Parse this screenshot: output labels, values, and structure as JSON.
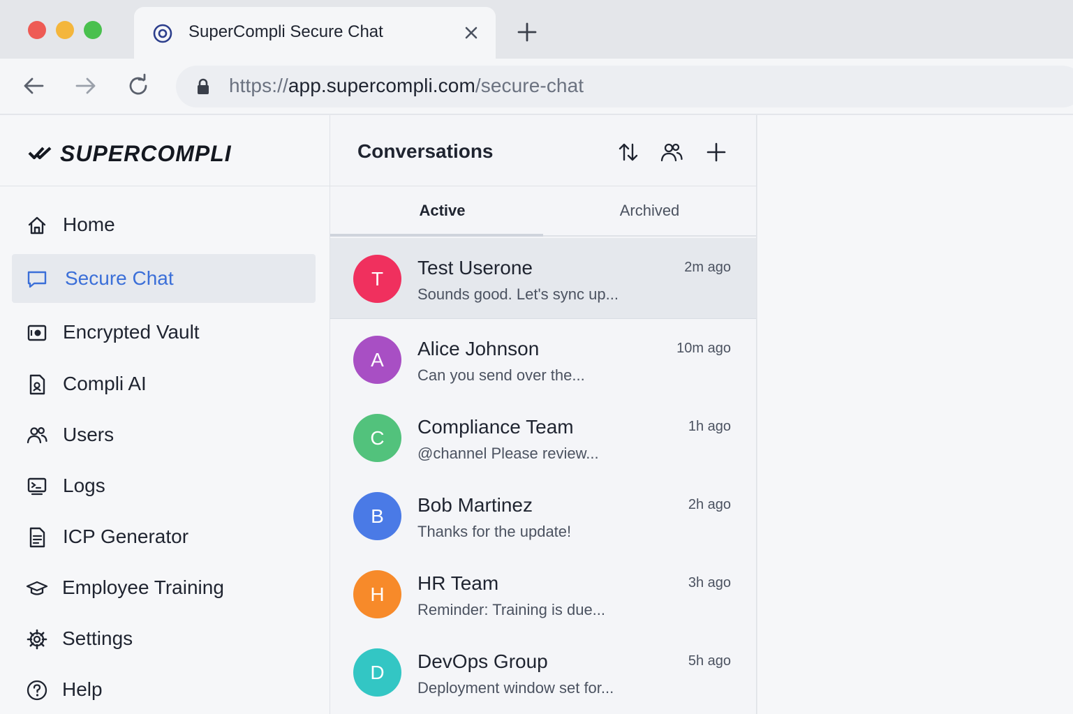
{
  "browser": {
    "tab": {
      "title": "SuperCompli Secure Chat"
    },
    "address": {
      "scheme": "https://",
      "host": "app.supercompli.com",
      "path": "/secure-chat"
    }
  },
  "sidebar": {
    "logo": "SUPERCOMPLI",
    "items": [
      {
        "label": "Home",
        "icon": "home-icon"
      },
      {
        "label": "Secure Chat",
        "icon": "chat-icon",
        "active": true
      },
      {
        "label": "Encrypted Vault",
        "icon": "vault-icon"
      },
      {
        "label": "Compli AI",
        "icon": "ai-document-icon"
      },
      {
        "label": "Users",
        "icon": "users-icon"
      },
      {
        "label": "Logs",
        "icon": "logs-icon"
      },
      {
        "label": "ICP Generator",
        "icon": "document-icon"
      },
      {
        "label": "Employee Training",
        "icon": "graduation-cap-icon"
      },
      {
        "label": "Settings",
        "icon": "gear-icon"
      },
      {
        "label": "Help",
        "icon": "help-icon"
      }
    ]
  },
  "conversations": {
    "title": "Conversations",
    "tabs": [
      "Active",
      "Archived"
    ],
    "items": [
      {
        "initial": "T",
        "name": "Test Userone",
        "preview": "Sounds good. Let's sync up...",
        "time": "2m ago",
        "color": "#f0305e"
      },
      {
        "initial": "A",
        "name": "Alice Johnson",
        "preview": "Can you send over the...",
        "time": "10m ago",
        "color": "#a84fc4"
      },
      {
        "initial": "C",
        "name": "Compliance Team",
        "preview": "@channel Please review...",
        "time": "1h ago",
        "color": "#52c27c"
      },
      {
        "initial": "B",
        "name": "Bob Martinez",
        "preview": "Thanks for the update!",
        "time": "2h ago",
        "color": "#4a7ae6"
      },
      {
        "initial": "H",
        "name": "HR Team",
        "preview": "Reminder: Training is due...",
        "time": "3h ago",
        "color": "#f78a2a"
      },
      {
        "initial": "D",
        "name": "DevOps Group",
        "preview": "Deployment window set for...",
        "time": "5h ago",
        "color": "#33c6c4"
      }
    ]
  },
  "colors": {
    "accent": "#3b6fd8"
  }
}
